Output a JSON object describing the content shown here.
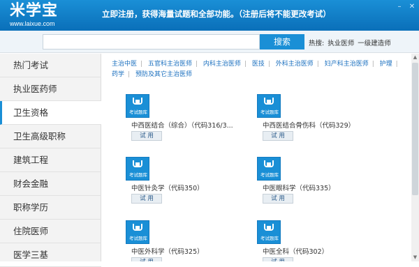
{
  "header": {
    "logo_text": "米学宝",
    "logo_url": "www.laixue.com",
    "notice": "立即注册，获得海量试题和全部功能。（注册后将不能更改考试）"
  },
  "search": {
    "value": "",
    "placeholder": "",
    "button_label": "搜索",
    "hot_label": "热搜:",
    "hot_items": [
      "执业医师",
      "一级建造师"
    ]
  },
  "sidebar": {
    "items": [
      {
        "label": "热门考试"
      },
      {
        "label": "执业医药师"
      },
      {
        "label": "卫生资格"
      },
      {
        "label": "卫生高级职称"
      },
      {
        "label": "建筑工程"
      },
      {
        "label": "财会金融"
      },
      {
        "label": "职称学历"
      },
      {
        "label": "住院医师"
      },
      {
        "label": "医学三基"
      }
    ],
    "active": "卫生资格"
  },
  "tags": [
    "主治中医",
    "五官科主治医师",
    "内科主治医师",
    "医技",
    "外科主治医师",
    "妇产科主治医师",
    "护理",
    "药学",
    "预防及其它主治医师"
  ],
  "cards": [
    {
      "icon_label": "考试题库",
      "title": "中西医结合（综合）（代码316/3...",
      "button": "试 用"
    },
    {
      "icon_label": "考试题库",
      "title": "中西医结合骨伤科（代码329）",
      "button": "试 用"
    },
    {
      "icon_label": "考试题库",
      "title": "中医针灸学（代码350）",
      "button": "试 用"
    },
    {
      "icon_label": "考试题库",
      "title": "中医眼科学（代码335）",
      "button": "试 用"
    },
    {
      "icon_label": "考试题库",
      "title": "中医外科学（代码325）",
      "button": "试 用"
    },
    {
      "icon_label": "考试题库",
      "title": "中医全科（代码302）",
      "button": "试 用"
    }
  ],
  "colors": {
    "accent": "#1a8fd6",
    "link": "#1a6fbf"
  }
}
